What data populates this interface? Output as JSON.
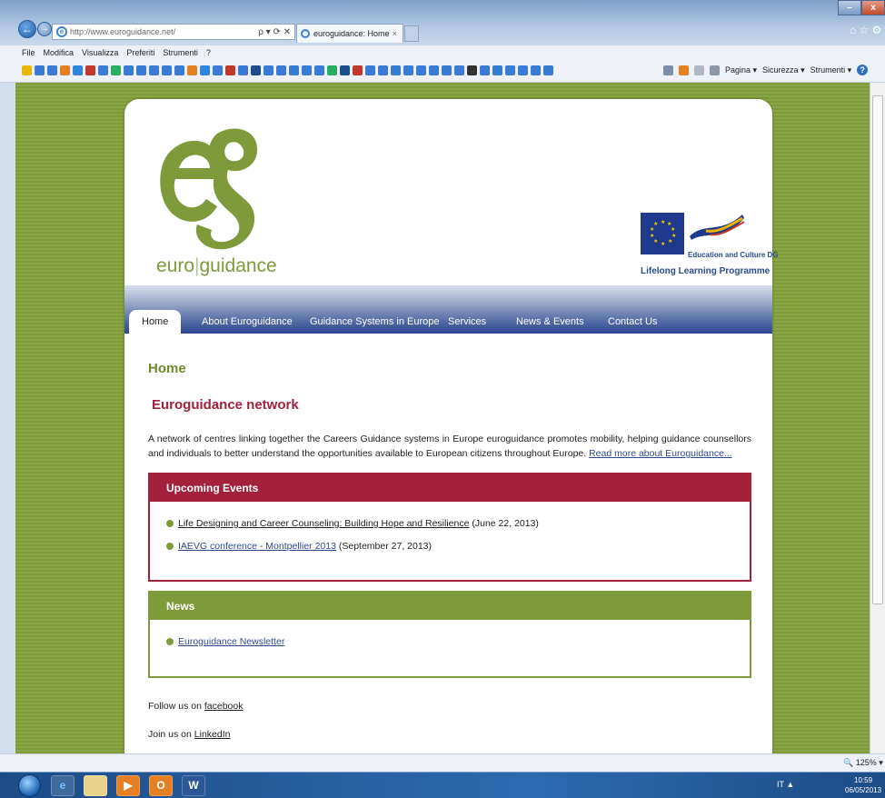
{
  "browser": {
    "address_url": "http://www.euroguidance.net/",
    "address_tools": "ρ ▾ ⟳ ✕",
    "tab_title": "euroguidance: Home",
    "tab_close": "×",
    "right_icons": "⌂ ☆ ⚙",
    "menu": [
      "File",
      "Modifica",
      "Visualizza",
      "Preferiti",
      "Strumenti",
      "?"
    ],
    "command_bar": [
      "Pagina ▾",
      "Sicurezza ▾",
      "Strumenti ▾"
    ],
    "help_label": "?",
    "zoom": "125%",
    "favorite_icon_colors": [
      "#e6b800",
      "#3a7bd5",
      "#3a7bd5",
      "#e67e22",
      "#2e86de",
      "#c0392b",
      "#3a7bd5",
      "#27ae60",
      "#3a7bd5",
      "#3a7bd5",
      "#3a7bd5",
      "#3a7bd5",
      "#3a7bd5",
      "#e67e22",
      "#2e86de",
      "#3a7bd5",
      "#c0392b",
      "#3a7bd5",
      "#1f4e8c",
      "#3a7bd5",
      "#3a7bd5",
      "#3a7bd5",
      "#3a7bd5",
      "#3a7bd5",
      "#27ae60",
      "#1f4e8c",
      "#c0392b",
      "#3a7bd5",
      "#3a7bd5",
      "#3a7bd5",
      "#3a7bd5",
      "#3a7bd5",
      "#3a7bd5",
      "#3a7bd5",
      "#3a7bd5",
      "#333333",
      "#3a7bd5",
      "#3a7bd5",
      "#3a7bd5",
      "#3a7bd5",
      "#3a7bd5",
      "#3a7bd5"
    ]
  },
  "site": {
    "logo_text_left": "euro",
    "logo_text_sep": "|",
    "logo_text_right": "guidance",
    "eu_dg": "Education and Culture DG",
    "eu_programme": "Lifelong Learning Programme",
    "nav": [
      "Home",
      "About Euroguidance",
      "Guidance Systems in Europe",
      "Services",
      "News & Events",
      "Contact Us"
    ],
    "page_title": "Home",
    "section_title": "Euroguidance network",
    "intro_text": "A network of centres linking together the Careers Guidance systems in Europe euroguidance promotes mobility, helping guidance counsellors and individuals to better understand the opportunities available to European citizens throughout Europe.",
    "intro_link": "Read more about Euroguidance...",
    "events": {
      "title": "Upcoming Events",
      "items": [
        {
          "link": "Life Designing and Career Counseling: Building Hope and Resilience",
          "date": "(June 22, 2013)"
        },
        {
          "link": "IAEVG conference - Montpellier 2013",
          "date": "(September 27, 2013)"
        }
      ]
    },
    "news": {
      "title": "News",
      "items": [
        {
          "link": "Euroguidance Newsletter"
        }
      ]
    },
    "follow_text": "Follow us on",
    "follow_link": "facebook",
    "join_text": "Join us on",
    "join_link": "LinkedIn"
  },
  "taskbar": {
    "buttons": [
      "",
      "e",
      "",
      "▶",
      "O",
      "W"
    ],
    "tray": "IT  ▲",
    "time": "10:59",
    "date": "06/05/2013"
  },
  "colors": {
    "brand_green": "#7f9a3b",
    "brand_red": "#a3213a",
    "nav_blue": "#2a4690"
  }
}
